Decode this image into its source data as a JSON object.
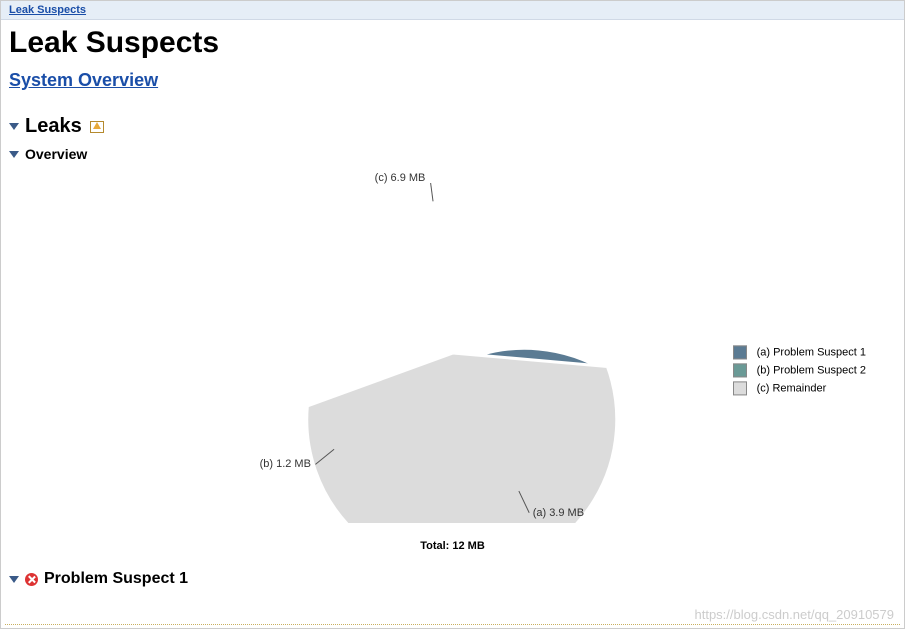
{
  "breadcrumb": {
    "label": "Leak Suspects"
  },
  "page_title": "Leak Suspects",
  "system_overview_label": "System Overview",
  "sections": {
    "leaks": "Leaks",
    "overview": "Overview",
    "problem1": "Problem Suspect 1"
  },
  "chart_data": {
    "type": "pie",
    "title": "",
    "total_label": "Total: 12 MB",
    "series": [
      {
        "key": "a",
        "name": "Problem Suspect 1",
        "value_mb": 3.9,
        "label": "(a)  3.9 MB",
        "color": "#5b7b93"
      },
      {
        "key": "b",
        "name": "Problem Suspect 2",
        "value_mb": 1.2,
        "label": "(b)  1.2 MB",
        "color": "#6a9a96"
      },
      {
        "key": "c",
        "name": "Remainder",
        "value_mb": 6.9,
        "label": "(c)  6.9 MB",
        "color": "#dcdcdc"
      }
    ],
    "legend": [
      {
        "swatch": "#5b7b93",
        "text": "(a)  Problem Suspect 1"
      },
      {
        "swatch": "#6a9a96",
        "text": "(b)  Problem Suspect 2"
      },
      {
        "swatch": "#dcdcdc",
        "text": "(c)  Remainder"
      }
    ]
  },
  "watermark": "https://blog.csdn.net/qq_20910579"
}
